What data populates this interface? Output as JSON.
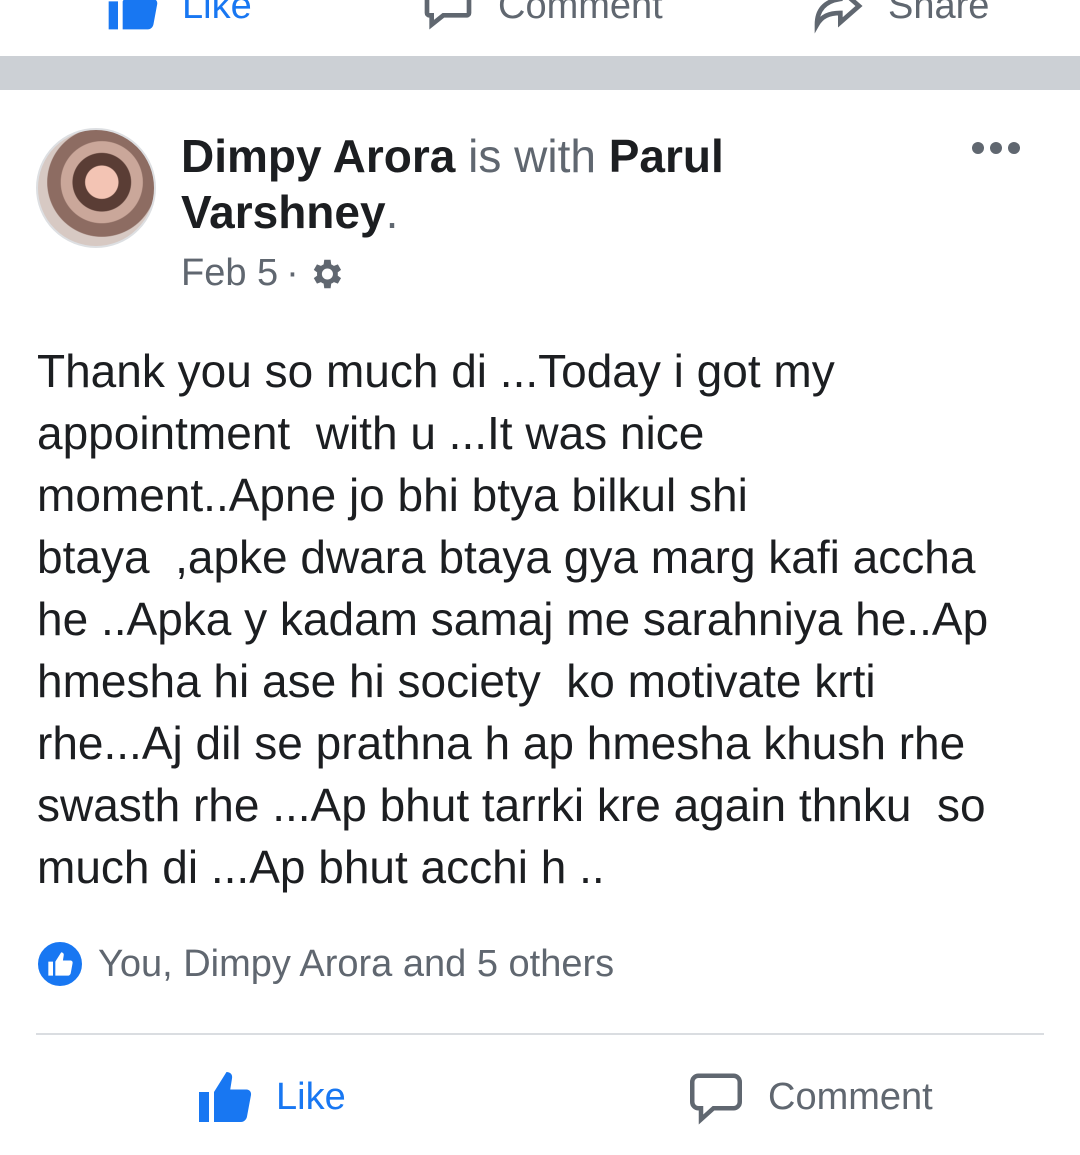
{
  "top_actions": {
    "like_label": "Like",
    "comment_label": "Comment",
    "share_label": "Share"
  },
  "post": {
    "author": "Dimpy Arora",
    "with_text": "is with",
    "tagged": "Parul Varshney",
    "period": ".",
    "date": "Feb 5",
    "date_separator": "·",
    "privacy_icon": "gear-icon",
    "body": "Thank you so much di ...Today i got my\nappointment  with u ...It was nice\nmoment..Apne jo bhi btya bilkul shi\nbtaya  ,apke dwara btaya gya marg kafi accha\nhe ..Apka y kadam samaj me sarahniya he..Ap\nhmesha hi ase hi society  ko motivate krti\nrhe...Aj dil se prathna h ap hmesha khush rhe\nswasth rhe ...Ap bhut tarrki kre again thnku  so\nmuch di ...Ap bhut acchi h ..",
    "reactions_text": "You, Dimpy Arora and 5 others"
  },
  "actions": {
    "like_label": "Like",
    "comment_label": "Comment"
  },
  "colors": {
    "accent": "#1877f2",
    "secondary_text": "#606770",
    "separator": "#ccd0d5"
  }
}
